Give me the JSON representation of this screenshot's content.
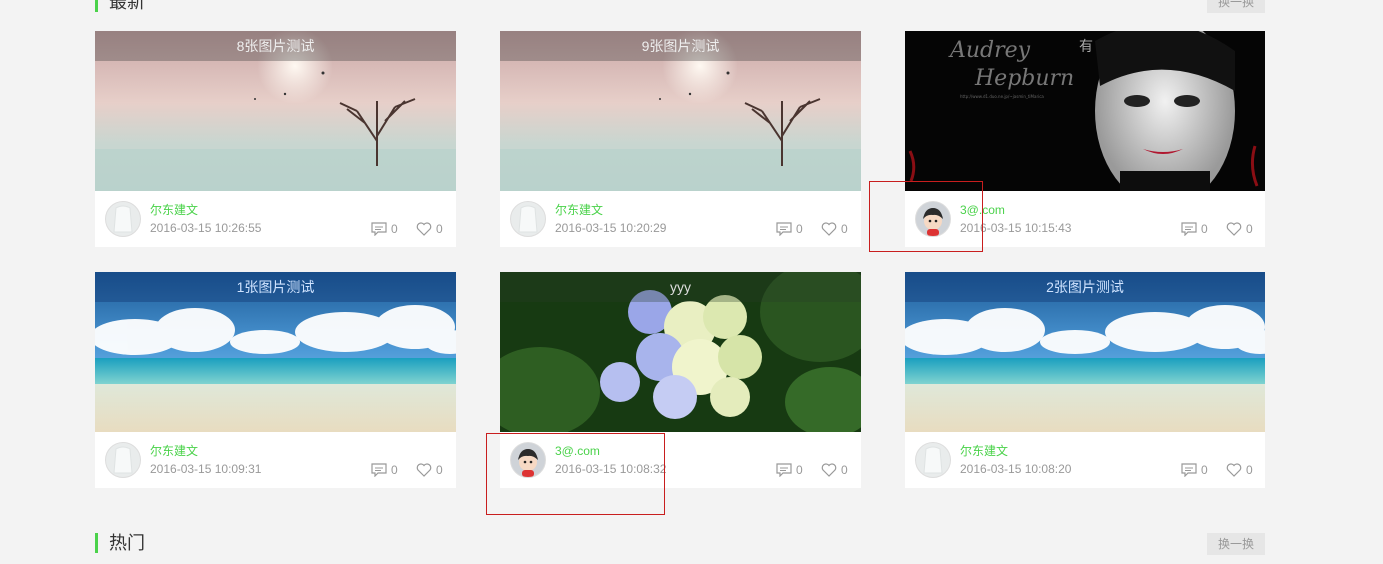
{
  "sections": {
    "latest": {
      "title": "最新",
      "swap_label": "换一换"
    },
    "hot": {
      "title": "热门",
      "swap_label": "换一换"
    }
  },
  "cards": [
    {
      "title": "8张图片测试",
      "author": "尔东建文",
      "time": "2016-03-15 10:26:55",
      "comments": "0",
      "likes": "0",
      "image": "tree-in-lake",
      "avatar": "default-avatar"
    },
    {
      "title": "9张图片测试",
      "author": "尔东建文",
      "time": "2016-03-15 10:20:29",
      "comments": "0",
      "likes": "0",
      "image": "tree-in-lake",
      "avatar": "default-avatar"
    },
    {
      "title": "有",
      "author": "3@.com",
      "time": "2016-03-15 10:15:43",
      "comments": "0",
      "likes": "0",
      "image": "audrey-hepburn",
      "avatar": "cartoon-avatar",
      "image_text": {
        "line1": "Audrey",
        "line2": "Hepburn",
        "url": "http://www.d1.duo.ne.jp/~jasmin_tiMarica"
      }
    },
    {
      "title": "1张图片测试",
      "author": "尔东建文",
      "time": "2016-03-15 10:09:31",
      "comments": "0",
      "likes": "0",
      "image": "beach",
      "avatar": "default-avatar"
    },
    {
      "title": "yyy",
      "author": "3@.com",
      "time": "2016-03-15 10:08:32",
      "comments": "0",
      "likes": "0",
      "image": "hydrangea",
      "avatar": "cartoon-avatar"
    },
    {
      "title": "2张图片测试",
      "author": "尔东建文",
      "time": "2016-03-15 10:08:20",
      "comments": "0",
      "likes": "0",
      "image": "beach",
      "avatar": "default-avatar"
    }
  ],
  "colors": {
    "accent": "#4ad24a",
    "highlight_box": "#c81e1e",
    "background": "#f3f3f3"
  },
  "icons": {
    "comment": "comment-icon",
    "like": "heart-icon"
  }
}
